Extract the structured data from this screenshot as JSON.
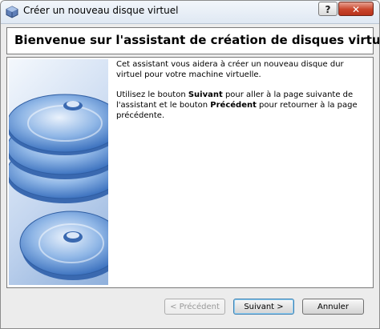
{
  "window": {
    "title": "Créer un nouveau disque virtuel",
    "help_label": "?",
    "close_label": "✕"
  },
  "header": {
    "title": "Bienvenue sur l'assistant de création de disques virtuels !"
  },
  "body": {
    "para1": "Cet assistant vous aidera à créer un nouveau disque dur virtuel pour votre machine virtuelle.",
    "para2_before": "Utilisez le bouton ",
    "para2_bold1": "Suivant",
    "para2_middle": " pour aller à la page suivante de l'assistant et le bouton ",
    "para2_bold2": "Précédent",
    "para2_after": " pour retourner à la page précédente."
  },
  "buttons": {
    "previous": "< Précédent",
    "next": "Suivant >",
    "cancel": "Annuler"
  },
  "colors": {
    "disc_blue": "#5a8fd0",
    "close_red": "#c9452b"
  },
  "icons": {
    "app": "virtualbox-icon",
    "watermark": "disc-stack-icon"
  }
}
